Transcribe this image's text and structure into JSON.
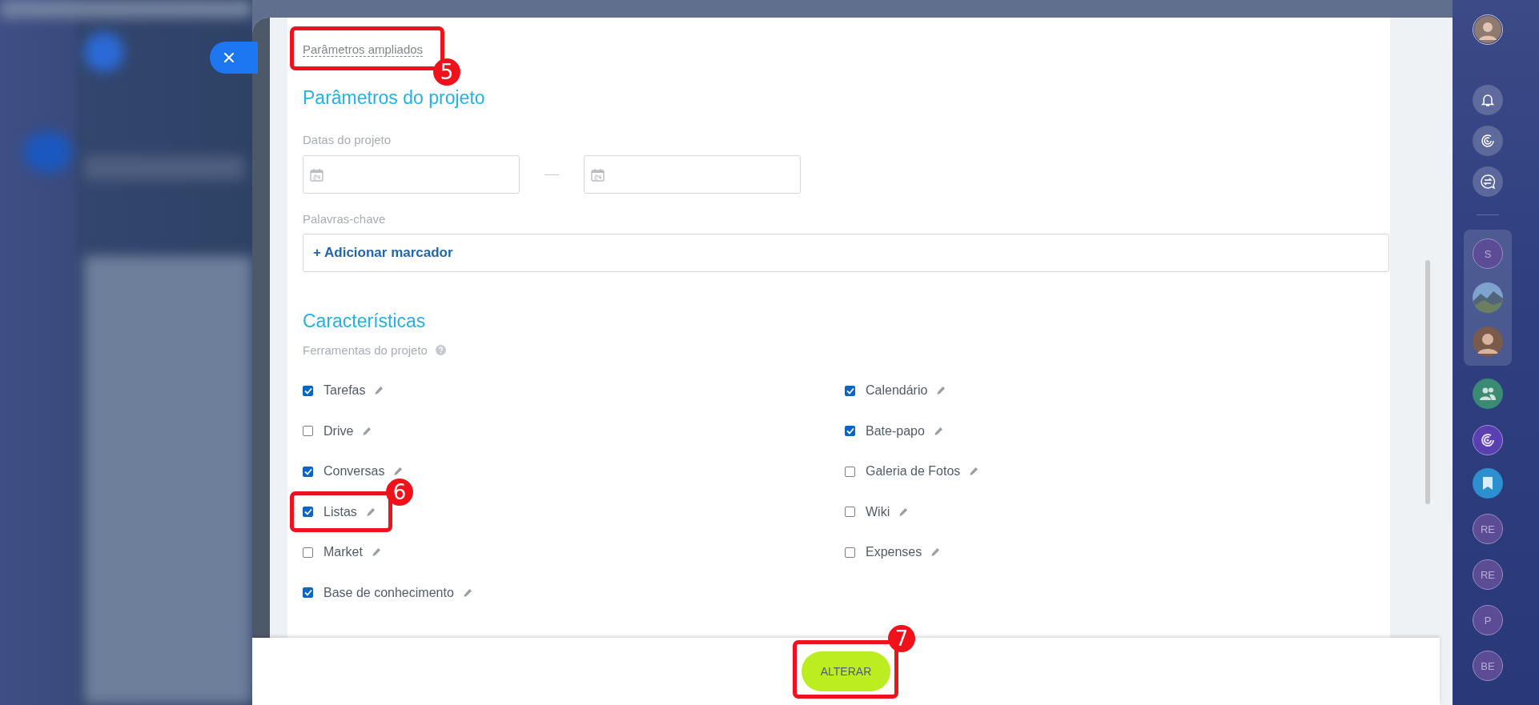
{
  "advanced_link": "Parâmetros ampliados",
  "project_section": {
    "title": "Parâmetros do projeto",
    "dates_label": "Datas do projeto",
    "keywords_label": "Palavras-chave",
    "add_tag": "+ Adicionar marcador"
  },
  "features": {
    "title": "Características",
    "tools_label": "Ferramentas do projeto",
    "tools": [
      [
        {
          "label": "Tarefas",
          "checked": true
        },
        {
          "label": "Drive",
          "checked": false
        },
        {
          "label": "Conversas",
          "checked": true
        },
        {
          "label": "Listas",
          "checked": true
        },
        {
          "label": "Market",
          "checked": false
        },
        {
          "label": "Base de conhecimento",
          "checked": true
        }
      ],
      [
        {
          "label": "Calendário",
          "checked": true
        },
        {
          "label": "Bate-papo",
          "checked": true
        },
        {
          "label": "Galeria de Fotos",
          "checked": false
        },
        {
          "label": "Wiki",
          "checked": false
        },
        {
          "label": "Expenses",
          "checked": false
        }
      ]
    ]
  },
  "footer": {
    "button": "ALTERAR"
  },
  "callouts": [
    {
      "number": "5"
    },
    {
      "number": "6"
    },
    {
      "number": "7"
    }
  ],
  "sidebar": {
    "pinned": [
      {
        "kind": "initials",
        "text": "S"
      },
      {
        "kind": "picture"
      },
      {
        "kind": "avatar"
      }
    ],
    "chats": [
      {
        "kind": "group"
      },
      {
        "kind": "app"
      },
      {
        "kind": "bookmark"
      },
      {
        "kind": "initials",
        "text": "RE"
      },
      {
        "kind": "initials",
        "text": "RE"
      },
      {
        "kind": "initials",
        "text": "P"
      },
      {
        "kind": "initials",
        "text": "BE"
      }
    ]
  }
}
